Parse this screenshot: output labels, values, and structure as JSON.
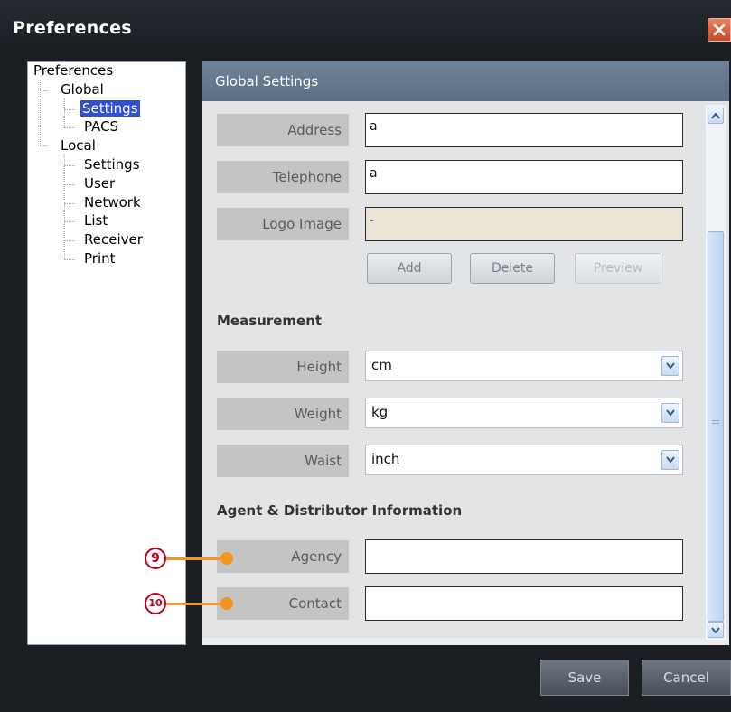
{
  "window": {
    "title": "Preferences"
  },
  "tree": {
    "root": "Preferences",
    "global": {
      "label": "Global",
      "children": [
        "Settings",
        "PACS"
      ],
      "selected": "Settings"
    },
    "local": {
      "label": "Local",
      "children": [
        "Settings",
        "User",
        "Network",
        "List",
        "Receiver",
        "Print"
      ]
    }
  },
  "panel": {
    "header": "Global Settings",
    "fields": {
      "address": {
        "label": "Address",
        "value": "a"
      },
      "telephone": {
        "label": "Telephone",
        "value": "a"
      },
      "logo": {
        "label": "Logo Image",
        "value": "-"
      }
    },
    "logo_buttons": {
      "add": "Add",
      "delete": "Delete",
      "preview": "Preview"
    },
    "measurement": {
      "title": "Measurement",
      "height": {
        "label": "Height",
        "value": "cm"
      },
      "weight": {
        "label": "Weight",
        "value": "kg"
      },
      "waist": {
        "label": "Waist",
        "value": "inch"
      }
    },
    "agent": {
      "title": "Agent & Distributor Information",
      "agency": {
        "label": "Agency",
        "value": ""
      },
      "contact": {
        "label": "Contact",
        "value": ""
      }
    }
  },
  "footer": {
    "save": "Save",
    "cancel": "Cancel"
  },
  "callouts": {
    "c9": "9",
    "c10": "10"
  },
  "colors": {
    "accent": "#f7941d",
    "selection": "#2e4fd6",
    "header": "#647890"
  },
  "icons": [
    "close-icon",
    "chevron-down-icon",
    "scroll-up-icon",
    "scroll-down-icon"
  ]
}
